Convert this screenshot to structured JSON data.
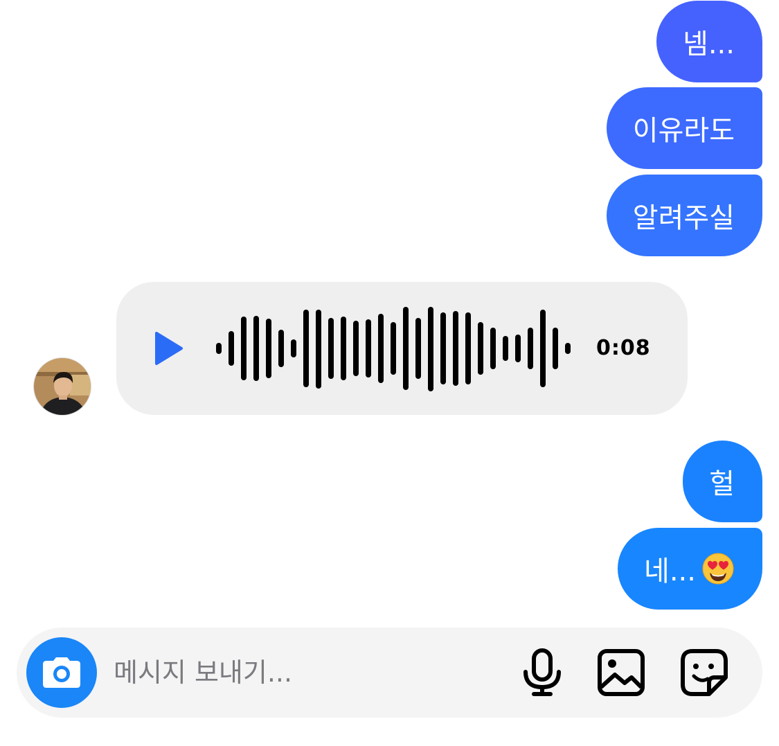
{
  "messages": [
    {
      "text": "넴..."
    },
    {
      "text": "이유라도"
    },
    {
      "text": "알려주실"
    },
    {
      "text": "헐"
    },
    {
      "text": "네...",
      "emoji": "heart-eyes-emoji"
    }
  ],
  "voice_message": {
    "duration": "0:08",
    "accent_color": "#2b6cf6",
    "icon": "play-icon"
  },
  "composer": {
    "placeholder": "메시지 보내기...",
    "icons": [
      "camera-icon",
      "microphone-icon",
      "image-icon",
      "sticker-icon"
    ],
    "camera_button_color": "#1a86f7"
  },
  "colors": {
    "outgoing_top": "#4562ff",
    "outgoing_bottom": "#1886ff",
    "incoming_bubble": "#efeff0"
  }
}
